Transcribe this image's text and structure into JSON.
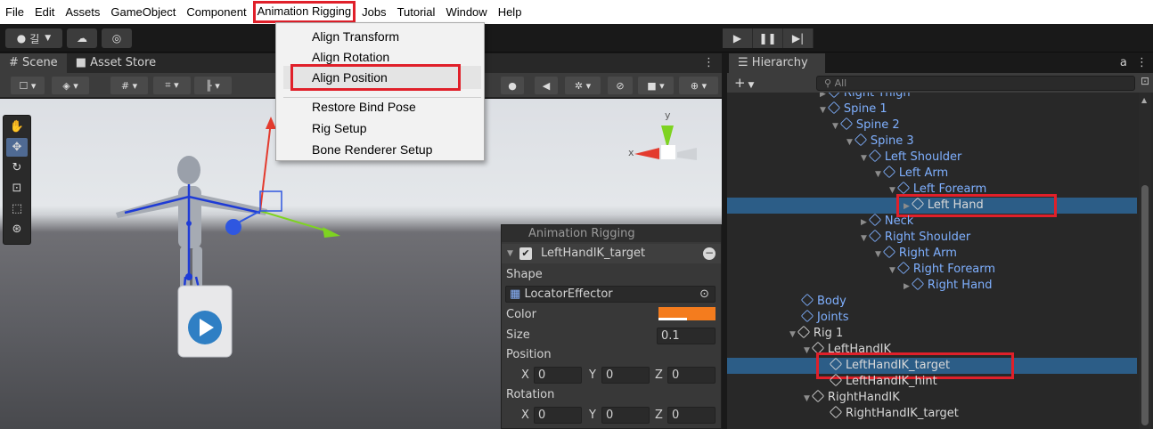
{
  "menubar": {
    "items": [
      "File",
      "Edit",
      "Assets",
      "GameObject",
      "Component",
      "Animation Rigging",
      "Jobs",
      "Tutorial",
      "Window",
      "Help"
    ]
  },
  "toolbar": {
    "account_label": "길"
  },
  "scene_panel": {
    "tabs": [
      "Scene",
      "Asset Store"
    ]
  },
  "animation_rigging_menu": {
    "items": [
      "Align Transform",
      "Align Rotation",
      "Align Position",
      "Restore Bind Pose",
      "Rig Setup",
      "Bone Renderer Setup"
    ]
  },
  "overlay": {
    "title": "Animation Rigging",
    "object_name": "LeftHandIK_target",
    "shape_label": "Shape",
    "shape_value": "LocatorEffector",
    "color_label": "Color",
    "color_value": "#f47c1e",
    "size_label": "Size",
    "size_value": "0.1",
    "position_label": "Position",
    "position": {
      "x": "0",
      "y": "0",
      "z": "0"
    },
    "rotation_label": "Rotation",
    "rotation": {
      "x": "0",
      "y": "0",
      "z": "0"
    },
    "axis_labels": {
      "x": "X",
      "y": "Y",
      "z": "Z"
    }
  },
  "gizmo": {
    "x_label": "x",
    "y_label": "y"
  },
  "hierarchy": {
    "tab_label": "Hierarchy",
    "search_placeholder": "All",
    "nodes": [
      "Right Thigh",
      "Spine 1",
      "Spine 2",
      "Spine 3",
      "Left Shoulder",
      "Left Arm",
      "Left Forearm",
      "Left Hand",
      "Neck",
      "Right Shoulder",
      "Right Arm",
      "Right Forearm",
      "Right Hand",
      "Body",
      "Joints",
      "Rig 1",
      "LeftHandIK",
      "LeftHandIK_target",
      "LeftHandIK_hint",
      "RightHandIK",
      "RightHandIK_target"
    ]
  }
}
